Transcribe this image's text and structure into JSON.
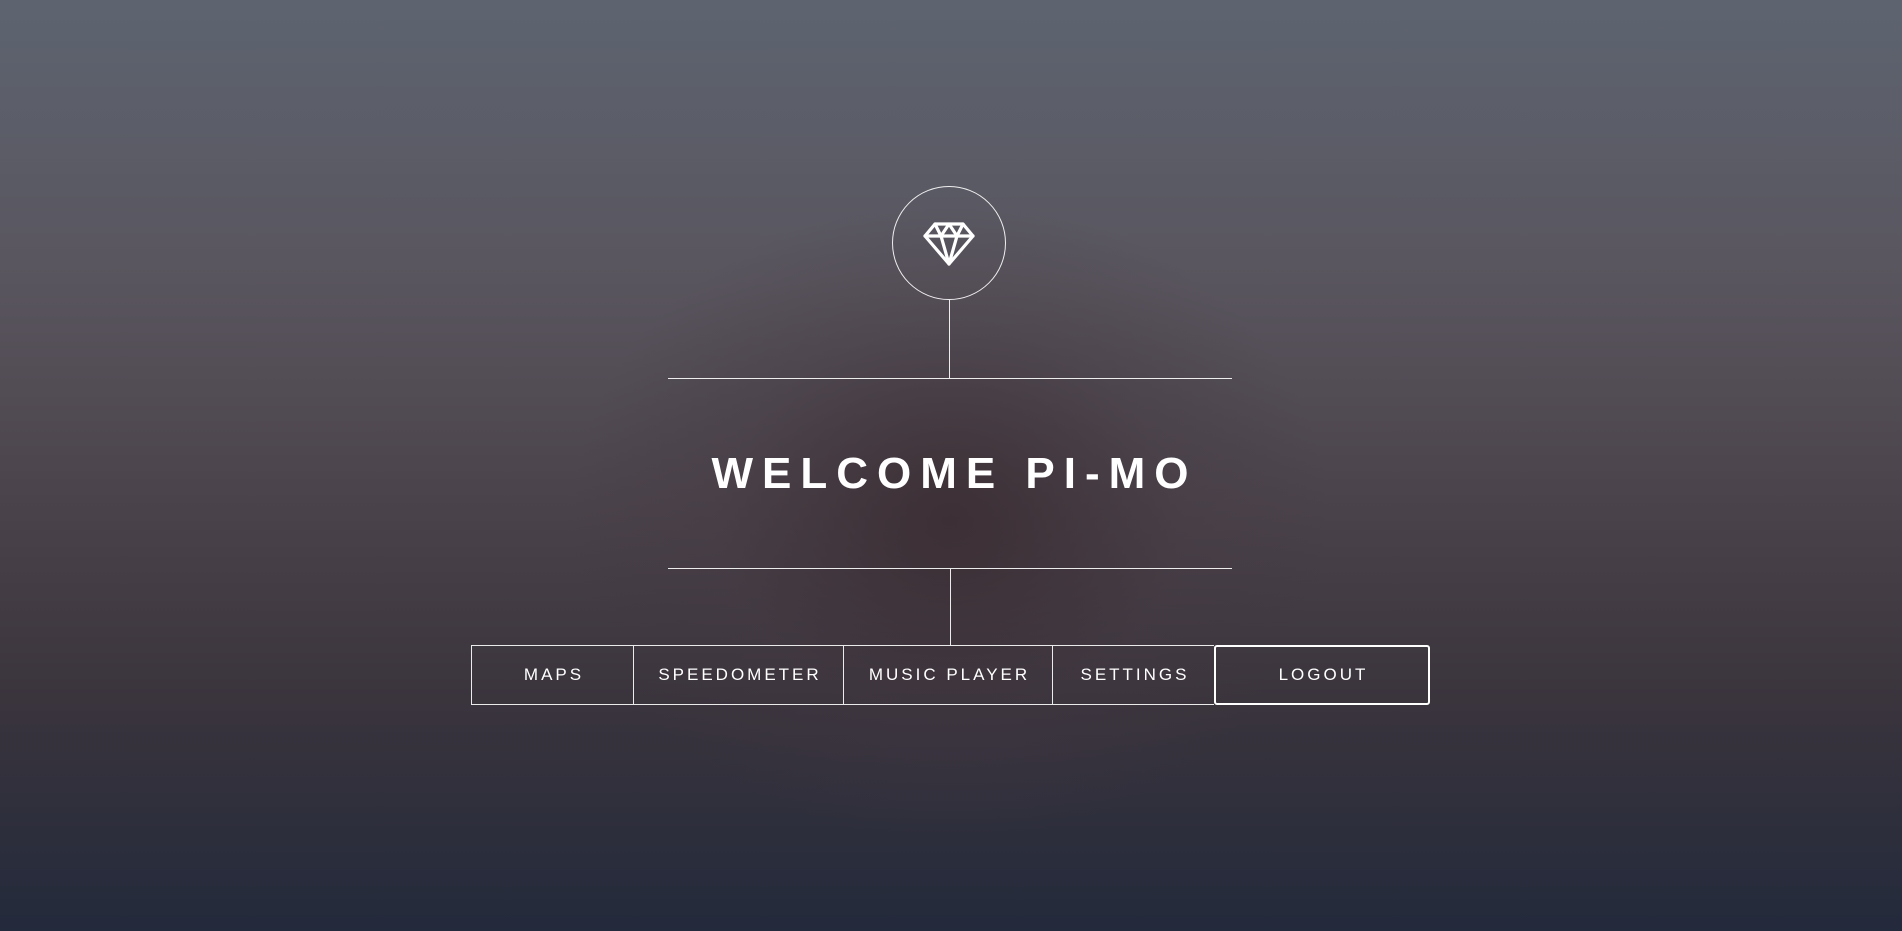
{
  "logo": {
    "icon": "diamond-icon"
  },
  "welcome": {
    "title": "WELCOME PI-MO"
  },
  "nav": {
    "items": [
      {
        "label": "MAPS"
      },
      {
        "label": "SPEEDOMETER"
      },
      {
        "label": "MUSIC PLAYER"
      },
      {
        "label": "SETTINGS"
      },
      {
        "label": "LOGOUT"
      }
    ]
  },
  "colors": {
    "line": "#ffffff",
    "text": "#ffffff",
    "background_top": "#5d6470",
    "background_bottom": "#232a3b"
  }
}
